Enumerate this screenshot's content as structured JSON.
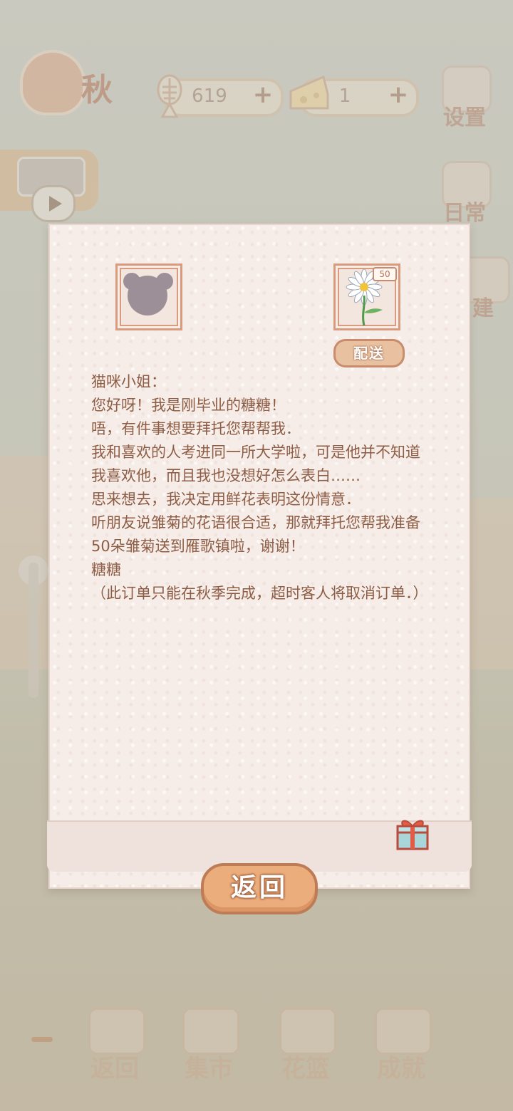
{
  "hud": {
    "season_label": "秋",
    "fish_count": "619",
    "cheese_count": "1",
    "plus": "+"
  },
  "side_buttons": {
    "settings": "设置",
    "daily": "日常",
    "build": "建"
  },
  "letter": {
    "quantity_badge": "50",
    "deliver_label": "配送",
    "lines": [
      "猫咪小姐：",
      "您好呀！我是刚毕业的糖糖！",
      "唔，有件事想要拜托您帮帮我．",
      "我和喜欢的人考进同一所大学啦，可是他并不知道我喜欢他，而且我也没想好怎么表白……",
      "思来想去，我决定用鲜花表明这份情意．",
      "听朋友说雏菊的花语很合适，那就拜托您帮我准备50朵雏菊送到雁歌镇啦，谢谢！",
      "糖糖",
      "（此订单只能在秋季完成，超时客人将取消订单．）"
    ]
  },
  "back_button": "返回",
  "bottom_nav": [
    "返回",
    "集市",
    "花篮",
    "成就"
  ],
  "colors": {
    "text_brown": "#8e5d45",
    "button_orange": "#ecad7c",
    "paper": "#f6ede8"
  }
}
